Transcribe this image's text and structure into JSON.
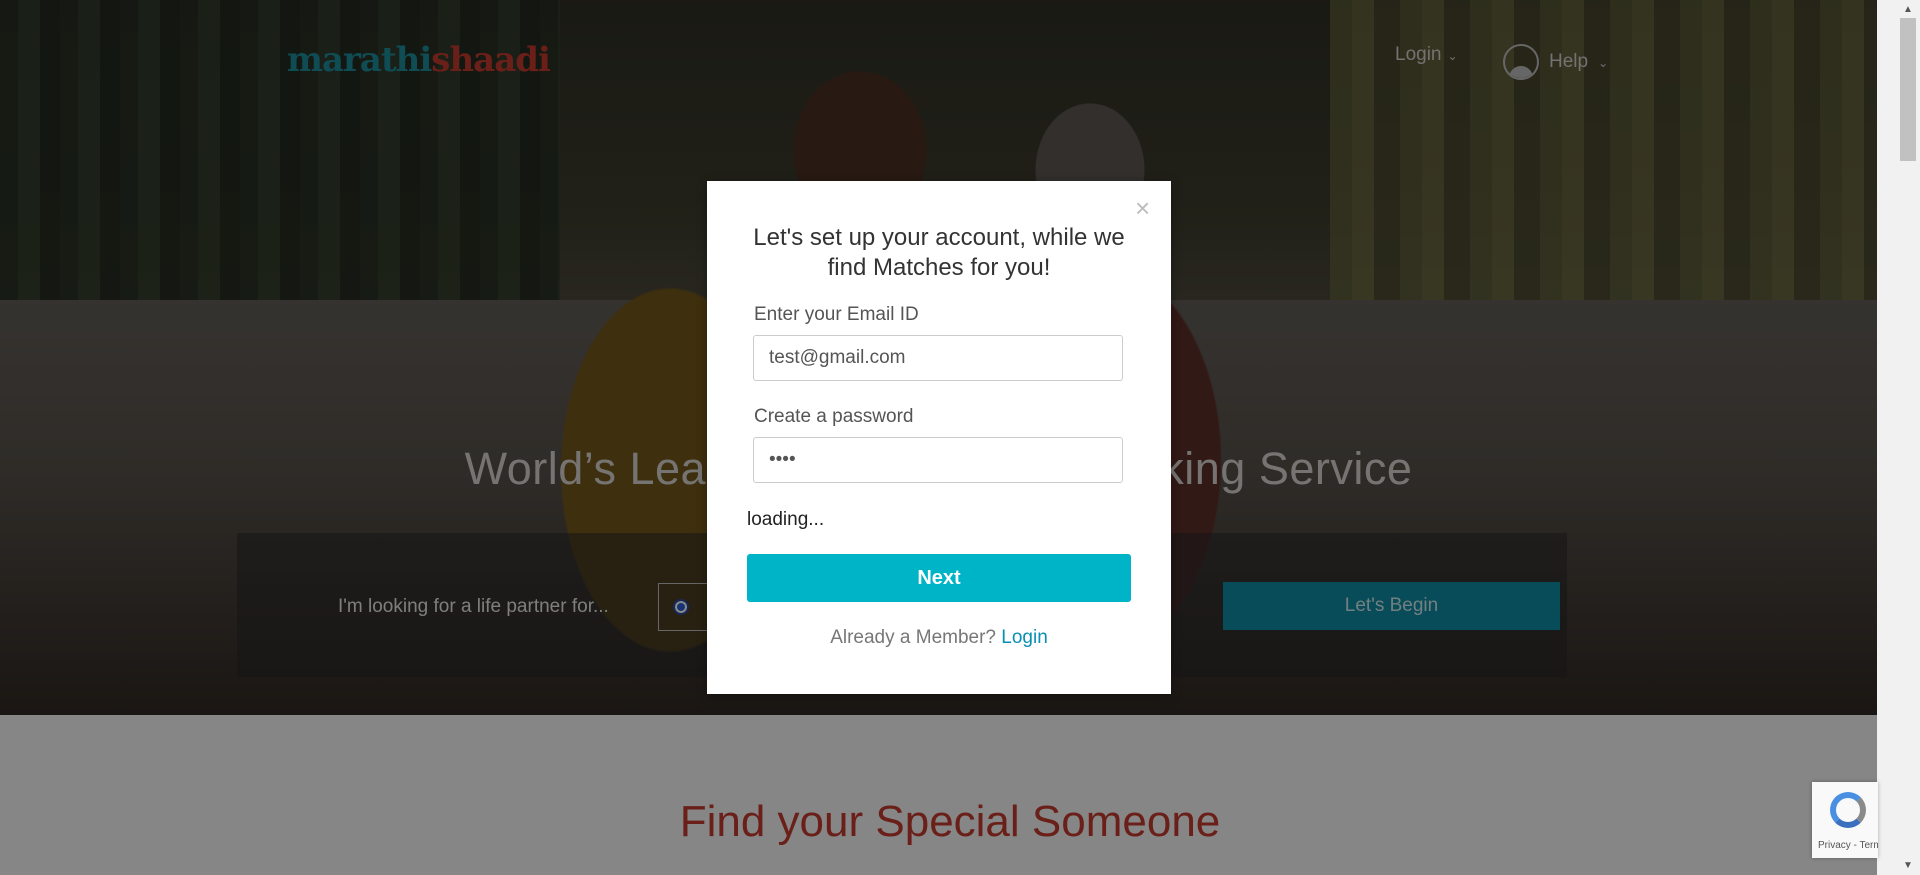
{
  "brand": {
    "logo_part1": "marathi",
    "logo_part2": "shaadi"
  },
  "nav": {
    "login_label": "Login",
    "help_label": "Help"
  },
  "hero": {
    "headline": "World’s Leading Marathi Matchmaking Service",
    "search_label": "I'm looking for a life partner for...",
    "begin_label": "Let's Begin"
  },
  "section": {
    "title": "Find your Special Someone"
  },
  "modal": {
    "title": "Let's set up your account, while we find Matches for you!",
    "email_label": "Enter your Email ID",
    "email_value": "test@gmail.com",
    "password_label": "Create a password",
    "password_value": "••••",
    "loading_text": "loading...",
    "next_label": "Next",
    "member_text": "Already a Member?",
    "member_link": "Login",
    "close_symbol": "×"
  },
  "recaptcha": {
    "text": "Privacy - Terms"
  },
  "colors": {
    "accent": "#00b4c8",
    "brand_teal": "#1c8b98",
    "brand_red": "#c23a2f"
  },
  "icons": [
    "chevron-down-icon",
    "user-avatar-icon",
    "close-icon",
    "recaptcha-icon"
  ]
}
